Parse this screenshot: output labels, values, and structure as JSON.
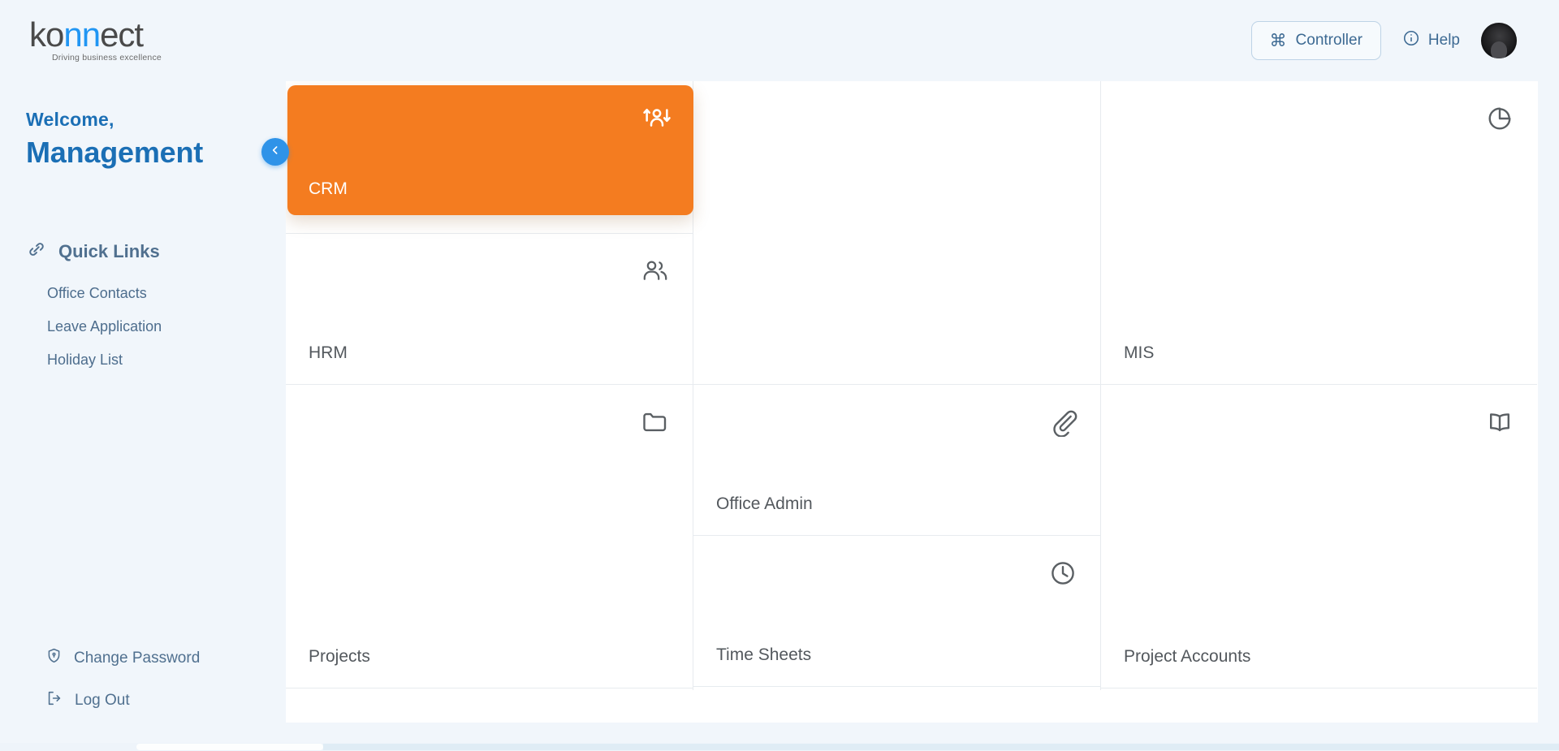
{
  "header": {
    "logo": {
      "text_left": "ko",
      "text_mid": "nn",
      "text_right": "ect",
      "tagline": "Driving business excellence"
    },
    "controller_label": "Controller",
    "controller_icon": "command-icon",
    "help_label": "Help",
    "help_icon": "info-circle-icon",
    "avatar_icon": "user-avatar"
  },
  "sidebar": {
    "welcome_label": "Welcome,",
    "user_name": "Management",
    "quick_links_title": "Quick Links",
    "quick_links_icon": "link-chain-icon",
    "quick_links": [
      {
        "label": "Office Contacts"
      },
      {
        "label": "Leave Application"
      },
      {
        "label": "Holiday List"
      }
    ],
    "actions": [
      {
        "label": "Change Password",
        "icon": "shield-key-icon"
      },
      {
        "label": "Log Out",
        "icon": "logout-icon"
      }
    ],
    "collapse_icon": "chevron-left-icon"
  },
  "modules": {
    "crm": {
      "label": "CRM",
      "icon": "user-transfer-icon",
      "color": "#f47c20",
      "active": true
    },
    "hrm": {
      "label": "HRM",
      "icon": "users-group-icon"
    },
    "mis": {
      "label": "MIS",
      "icon": "pie-chart-icon"
    },
    "projects": {
      "label": "Projects",
      "icon": "folder-icon"
    },
    "office_admin": {
      "label": "Office Admin",
      "icon": "paperclip-icon"
    },
    "time_sheets": {
      "label": "Time Sheets",
      "icon": "clock-icon"
    },
    "project_accounts": {
      "label": "Project Accounts",
      "icon": "open-book-icon"
    }
  },
  "colors": {
    "accent_blue": "#1b6fb5",
    "orange": "#f47c20",
    "panel": "#ffffff",
    "page_bg": "#f1f6fb"
  }
}
